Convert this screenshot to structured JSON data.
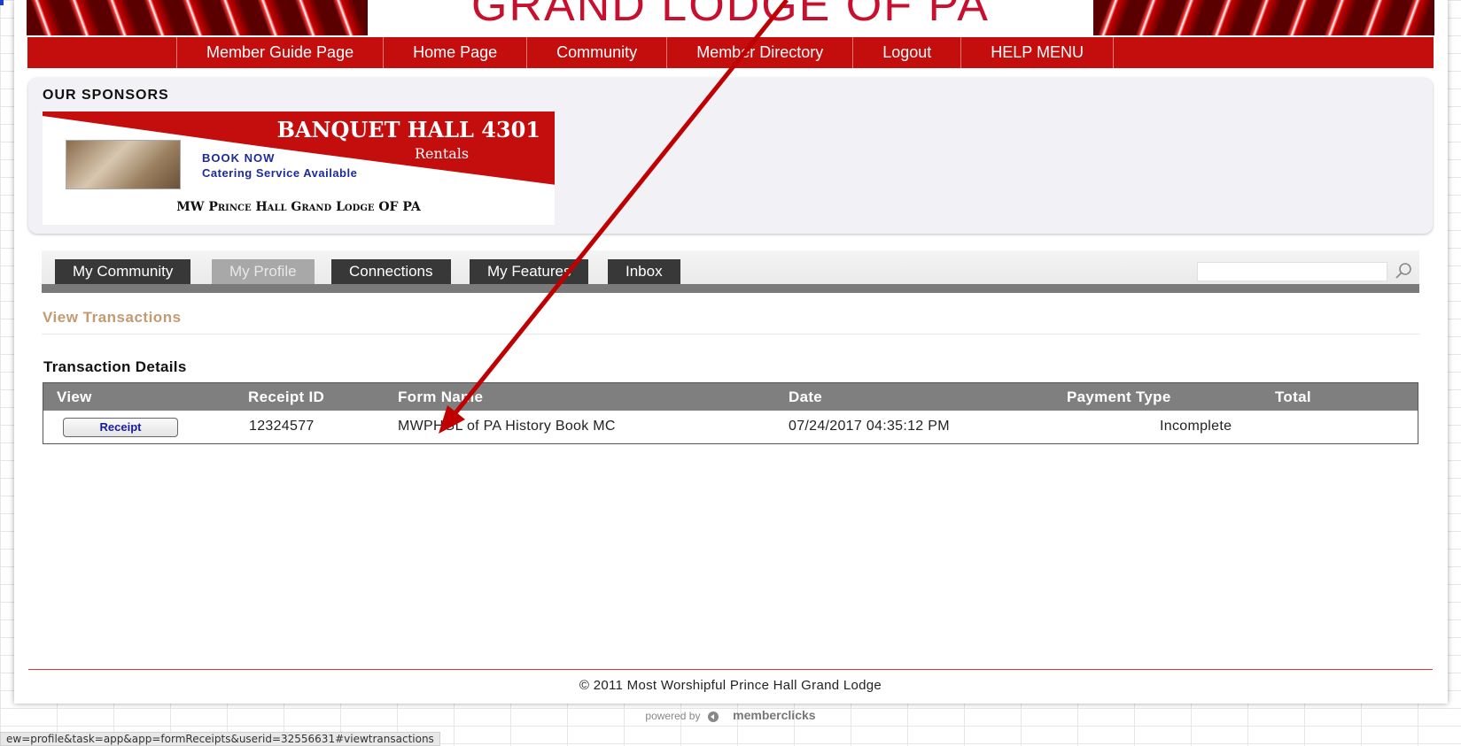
{
  "header": {
    "banner_title": "GRAND LODGE OF PA"
  },
  "nav": {
    "items": [
      {
        "label": "Member Guide Page"
      },
      {
        "label": "Home Page"
      },
      {
        "label": "Community"
      },
      {
        "label": "Member Directory"
      },
      {
        "label": "Logout"
      },
      {
        "label": "HELP MENU"
      }
    ]
  },
  "sponsors": {
    "title": "OUR SPONSORS",
    "ad": {
      "headline": "BANQUET HALL 4301",
      "subline": "Rentals",
      "cta": "BOOK NOW",
      "service": "Catering Service Available",
      "org": "MW Prince Hall Grand Lodge OF PA"
    }
  },
  "tabs": [
    {
      "label": "My Community",
      "active": false
    },
    {
      "label": "My Profile",
      "active": true
    },
    {
      "label": "Connections",
      "active": false
    },
    {
      "label": "My Features",
      "active": false
    },
    {
      "label": "Inbox",
      "active": false
    }
  ],
  "search": {
    "placeholder": "",
    "icon": "search-icon"
  },
  "main": {
    "section_link": "View Transactions",
    "details_title": "Transaction Details",
    "table": {
      "columns": [
        "View",
        "Receipt ID",
        "Form Name",
        "Date",
        "Payment Type",
        "Total"
      ],
      "rows": [
        {
          "view_button": "Receipt",
          "receipt_id": "12324577",
          "form_name": "MWPHGL of PA History Book MC",
          "date": "07/24/2017 04:35:12 PM",
          "payment_type": "Incomplete",
          "total": ""
        }
      ]
    }
  },
  "footer": {
    "copyright": "© 2011 Most Worshipful Prince Hall Grand Lodge",
    "powered_by": "powered by",
    "brand": "memberclicks"
  },
  "status_bar": {
    "url": "ew=profile&task=app&app=formReceipts&userid=32556631#viewtransactions"
  },
  "colors": {
    "brand_red": "#c40d0d",
    "annotation_arrow": "#c00000",
    "tab_dark": "#383838",
    "tab_active": "#a8a8a8",
    "table_header": "#7f7f7f",
    "section_link": "#c49a73"
  }
}
